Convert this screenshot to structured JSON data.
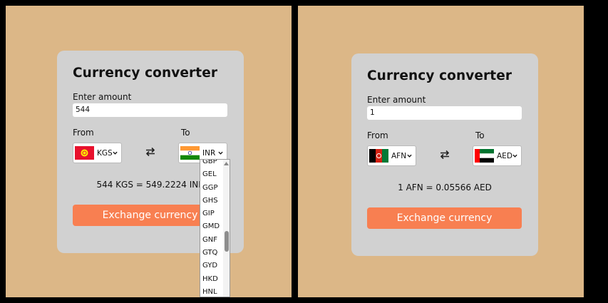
{
  "left": {
    "title": "Currency converter",
    "amount_label": "Enter amount",
    "amount_value": "544",
    "from_label": "From",
    "to_label": "To",
    "from_code": "KGS",
    "to_code": "INR",
    "result": "544 KGS = 549.2224 INR",
    "button_label": "Exchange currency",
    "dropdown_options": [
      "GBP",
      "GEL",
      "GGP",
      "GHS",
      "GIP",
      "GMD",
      "GNF",
      "GTQ",
      "GYD",
      "HKD",
      "HNL"
    ]
  },
  "right": {
    "title": "Currency converter",
    "amount_label": "Enter amount",
    "amount_value": "1",
    "from_label": "From",
    "to_label": "To",
    "from_code": "AFN",
    "to_code": "AED",
    "result": "1 AFN = 0.05566 AED",
    "button_label": "Exchange currency"
  },
  "icons": {
    "swap": "swap-arrows-icon",
    "chevron": "chevron-down-icon",
    "flags": [
      "kyrgyzstan-flag-icon",
      "india-flag-icon",
      "afghanistan-flag-icon",
      "uae-flag-icon"
    ]
  },
  "colors": {
    "background": "#dcb787",
    "card": "#d1d1d1",
    "button": "#f87f51"
  }
}
